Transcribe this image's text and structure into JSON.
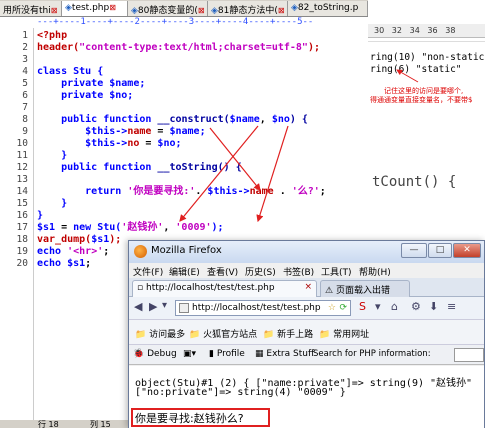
{
  "editor": {
    "tabs": [
      {
        "label": "用所没有thi",
        "x": "⊠"
      },
      {
        "label": "test.php",
        "x": "⊠"
      },
      {
        "label": "80静态变量的(",
        "x": "⊠"
      },
      {
        "label": "81静态方法中(",
        "x": "⊠"
      },
      {
        "label": "82_toString.p",
        "x": "⊠"
      }
    ],
    "ruler": "---+----1----+----2----+----3----+----4----+----5--",
    "line_numbers": [
      "1",
      "2",
      "3",
      "4",
      "5",
      "6",
      "7",
      "8",
      "9",
      "10",
      "11",
      "12",
      "13",
      "14",
      "15",
      "16",
      "17",
      "18",
      "19",
      "20"
    ],
    "lines": {
      "l1": "<?php",
      "l2_fn": "header(",
      "l2_str": "\"content-type:text/html;charset=utf-8\"",
      "l2_end": ");",
      "l4_kw": "class ",
      "l4_name": "Stu {",
      "l5_kw": "    private ",
      "l5_var": "$name;",
      "l6_kw": "    private ",
      "l6_var": "$no;",
      "l8_kw": "    public function ",
      "l8_fn": "__construct(",
      "l8_a1": "$name",
      "l8_c": ", ",
      "l8_a2": "$no",
      "l8_end": ") {",
      "l9_this": "        $this->",
      "l9_prop": "name",
      "l9_eq": " = ",
      "l9_var": "$name;",
      "l10_this": "        $this->",
      "l10_prop": "no",
      "l10_eq": " = ",
      "l10_var": "$no;",
      "l11": "    }",
      "l12_kw": "    public function ",
      "l12_fn": "__toString() {",
      "l14_kw": "        return ",
      "l14_s1": "'你是要寻找:'",
      "l14_dot": ". ",
      "l14_this": "$this->",
      "l14_prop": "name",
      "l14_dot2": " . ",
      "l14_s2": "'么?'",
      "l14_end": ";",
      "l15": "    }",
      "l16": "}",
      "l17_var": "$s1",
      "l17_eq": " = ",
      "l17_kw": "new ",
      "l17_cls": "Stu(",
      "l17_s1": "'赵钱孙'",
      "l17_c": ", ",
      "l17_s2": "'0009'",
      "l17_end": ");",
      "l18_fn": "var_dump(",
      "l18_var": "$s1",
      "l18_end": ");",
      "l19_kw": "echo ",
      "l19_s": "'<hr>'",
      "l19_end": ";",
      "l20_kw": "echo ",
      "l20_var": "$s1",
      "l20_end": ";"
    }
  },
  "right_pane": {
    "ruler": "30   32   34   36   38",
    "line1": "ring(10) \"non-static\"",
    "line2": "ring(6) \"static\"",
    "note1": "记住这里的访问是要哪个,",
    "note2": "得通通变量直接变量名，不要带$",
    "big": "tCount() {"
  },
  "status": {
    "line": "行 18",
    "col": "列 15"
  },
  "firefox": {
    "title": "Mozilla Firefox",
    "buttons": {
      "min": "—",
      "max": "□",
      "close": "✕"
    },
    "menu": [
      "文件(F)",
      "编辑(E)",
      "查看(V)",
      "历史(S)",
      "书签(B)",
      "工具(T)",
      "帮助(H)"
    ],
    "tabs": [
      {
        "label": "http://localhost/test/test.php",
        "close": "×"
      },
      {
        "label": "页面载入出错",
        "close": ""
      }
    ],
    "url": "http://localhost/test/test.php",
    "nav": {
      "back": "◀",
      "forward": "▶",
      "reload": "⟳",
      "home": "⌂",
      "search": "S"
    },
    "bookmarks": [
      "访问最多",
      "火狐官方站点",
      "新手上路",
      "常用网址"
    ],
    "debugbar": [
      "Debug",
      "Profile",
      "Extra Stuff",
      "Search for PHP information:"
    ],
    "content": {
      "dump_line1": "object(Stu)#1 (2) { [\"name:private\"]=> string(9) \"赵钱孙\"",
      "dump_line2": "[\"no:private\"]=> string(4) \"0009\" }",
      "result": "你是要寻找:赵钱孙么?"
    }
  },
  "colors": {
    "keyword": "#0000ff",
    "string": "#c000c0",
    "annotation": "#e02020"
  }
}
